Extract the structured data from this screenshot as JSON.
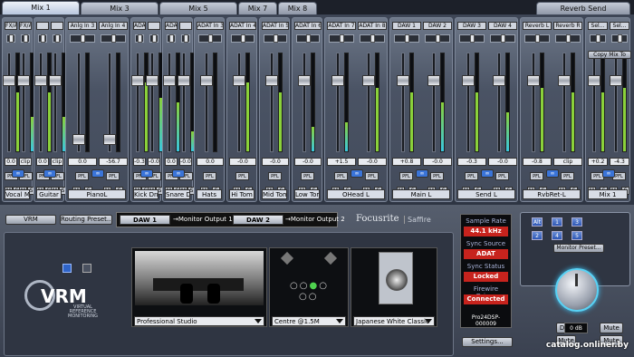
{
  "tabs": [
    "Mix 1",
    "Mix 3",
    "Mix 5",
    "Mix 7",
    "Mix 8",
    "Reverb Send"
  ],
  "groups": [
    {
      "label": "Vocal Mic",
      "strips": [
        {
          "input": "FX/Anlg 1",
          "value": "0.0",
          "level": 0.6
        },
        {
          "input": "FX/Anlg 2",
          "value": "clip",
          "level": 0.35
        }
      ]
    },
    {
      "label": "Guitar",
      "strips": [
        {
          "input": "",
          "value": "0.0",
          "level": 0.6
        },
        {
          "input": "",
          "value": "clip",
          "level": 0.35
        }
      ]
    },
    {
      "label": "PianoL",
      "strips": [
        {
          "input": "Anlg In 3",
          "value": "0.0",
          "level": 0
        },
        {
          "input": "Anlg In 4",
          "value": "-56.7",
          "level": 0
        }
      ]
    },
    {
      "label": "Kick Drm",
      "strips": [
        {
          "input": "ADAT In 1",
          "value": "-0.3",
          "level": 0.7
        },
        {
          "input": "",
          "value": "-0.0",
          "level": 0.55
        }
      ]
    },
    {
      "label": "Snare Drm",
      "strips": [
        {
          "input": "ADAT In 2",
          "value": "0.0",
          "level": 0.5
        },
        {
          "input": "",
          "value": "-0.0",
          "level": 0.2
        }
      ]
    },
    {
      "label": "Hats",
      "strips": [
        {
          "input": "ADAT In 3",
          "value": "0.0",
          "level": 0
        }
      ]
    },
    {
      "label": "Hi Tom",
      "strips": [
        {
          "input": "ADAT In 4",
          "value": "-0.0",
          "level": 0.7
        }
      ]
    },
    {
      "label": "Mid Tom",
      "strips": [
        {
          "input": "ADAT In 5",
          "value": "-0.0",
          "level": 0.6
        }
      ]
    },
    {
      "label": "Low Tom",
      "strips": [
        {
          "input": "ADAT In 6",
          "value": "-0.0",
          "level": 0.25
        }
      ]
    },
    {
      "label": "OHead L",
      "strips": [
        {
          "input": "ADAT In 7",
          "value": "+1.5",
          "level": 0.3
        },
        {
          "input": "ADAT In 8",
          "value": "-0.0",
          "level": 0.65
        }
      ]
    },
    {
      "label": "Main L",
      "strips": [
        {
          "input": "DAW 1",
          "value": "+0.8",
          "level": 0.6
        },
        {
          "input": "DAW 2",
          "value": "-0.0",
          "level": 0.5
        }
      ]
    },
    {
      "label": "Send L",
      "strips": [
        {
          "input": "DAW 3",
          "value": "-0.3",
          "level": 0.6
        },
        {
          "input": "DAW 4",
          "value": "-0.0",
          "level": 0.4
        }
      ]
    },
    {
      "label": "RvbRet-L",
      "strips": [
        {
          "input": "Reverb L",
          "value": "-0.8",
          "level": 0.65
        },
        {
          "input": "Reverb R",
          "value": "clip",
          "level": 0.6
        }
      ]
    },
    {
      "label": "Mix 1",
      "strips": [
        {
          "input": "Sel...",
          "value": "+0.2",
          "level": 0.6
        },
        {
          "input": "Sel...",
          "value": "-4.3",
          "level": 0.65
        }
      ]
    }
  ],
  "copy_mix_label": "Copy Mix To",
  "clip_label": "clip",
  "pfl_label": "PFL",
  "mute_label": "M",
  "solo_label": "S",
  "bottom": {
    "vrm_button": "VRM",
    "routing_preset": "Routing Preset...",
    "routes": [
      {
        "daw": "DAW 1",
        "target": "→Monitor Output 1"
      },
      {
        "daw": "DAW 2",
        "target": "→Monitor Output 2"
      }
    ],
    "brand": "Focusrite",
    "product": "Saffire",
    "vrm_logo": "VRM",
    "vrm_sub": [
      "VIRTUAL",
      "REFERENCE",
      "MONITORING"
    ],
    "room": "Professional Studio",
    "position": "Centre @1.5M",
    "speaker": "Japanese White Classic",
    "status": [
      {
        "label": "Sample Rate",
        "value": "44.1 kHz"
      },
      {
        "label": "Sync Source",
        "value": "ADAT"
      },
      {
        "label": "Sync Status",
        "value": "Locked"
      },
      {
        "label": "Firewire Driver",
        "value": "Connected"
      }
    ],
    "device_id": "Pro24DSP-000009",
    "settings_button": "Settings...",
    "monitor_preset": "Monitor Preset...",
    "monitor_buttons": [
      "Alt",
      "1",
      "2",
      "3",
      "4",
      "5"
    ],
    "db_value": "0 dB",
    "dim": "Dim",
    "mute": "Mute",
    "mute_left": "Mute",
    "mute_right": "Mute"
  },
  "watermark": "catalog.onliner.by",
  "colors": {
    "meter_green": "#8ad13a",
    "meter_cyan": "#39c7e0",
    "stereo_on": "#3a74d8",
    "status_red": "#c7231d"
  }
}
